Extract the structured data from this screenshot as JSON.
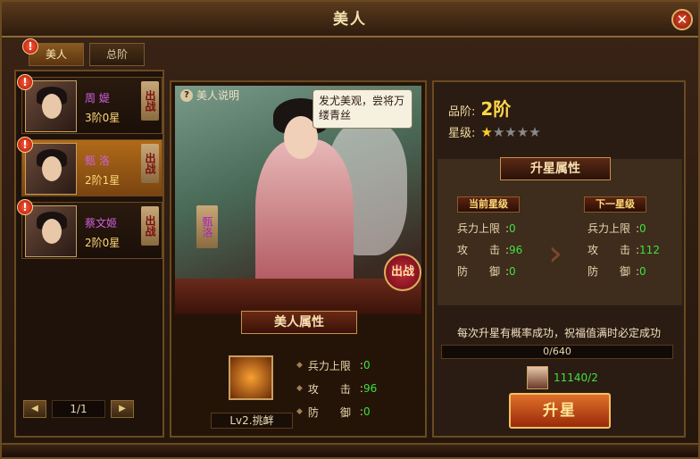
{
  "window": {
    "title": "美人",
    "close": "✕"
  },
  "tabs": [
    {
      "label": "美人",
      "badge": "!"
    },
    {
      "label": "总阶"
    }
  ],
  "beauties": [
    {
      "name": "周 媞",
      "level": "3阶0星",
      "deploy": "出战",
      "badge": "!"
    },
    {
      "name": "甄 洛",
      "level": "2阶1星",
      "deploy": "出战",
      "badge": "!"
    },
    {
      "name": "蔡文姬",
      "level": "2阶0星",
      "deploy": "出战",
      "badge": "!"
    }
  ],
  "pager": {
    "prev": "◀",
    "page": "1/1",
    "next": "▶"
  },
  "center": {
    "help": "美人说明",
    "help_icon": "?",
    "speech": "发尤美观，尝将万缕青丝",
    "name_vertical": "甄洛",
    "fight": "出战",
    "attr_title": "美人属性",
    "skill_label": "Lv2.挑衅",
    "stats": [
      {
        "label": "兵力上限",
        "value": "0"
      },
      {
        "label": "攻　　击",
        "value": "96"
      },
      {
        "label": "防　　御",
        "value": "0"
      }
    ]
  },
  "right": {
    "grade_label": "品阶:",
    "grade_value": "2阶",
    "star_label": "星级:",
    "stars_lit": 1,
    "stars_total": 5,
    "uptitle": "升星属性",
    "current_title": "当前星级",
    "next_title": "下一星级",
    "current": [
      {
        "label": "兵力上限",
        "value": "0"
      },
      {
        "label": "攻　　击",
        "value": "96"
      },
      {
        "label": "防　　御",
        "value": "0"
      }
    ],
    "next": [
      {
        "label": "兵力上限",
        "value": "0"
      },
      {
        "label": "攻　　击",
        "value": "112"
      },
      {
        "label": "防　　御",
        "value": "0"
      }
    ],
    "luck_text": "每次升星有概率成功，祝福值满时必定成功",
    "progress": "0/640",
    "progress_fraction": 0,
    "cost": "11140/2",
    "upgrade": "升星"
  },
  "colors": {
    "green_value": "#40e040",
    "gold": "#ffd848",
    "purple_name": "#d060e0"
  }
}
